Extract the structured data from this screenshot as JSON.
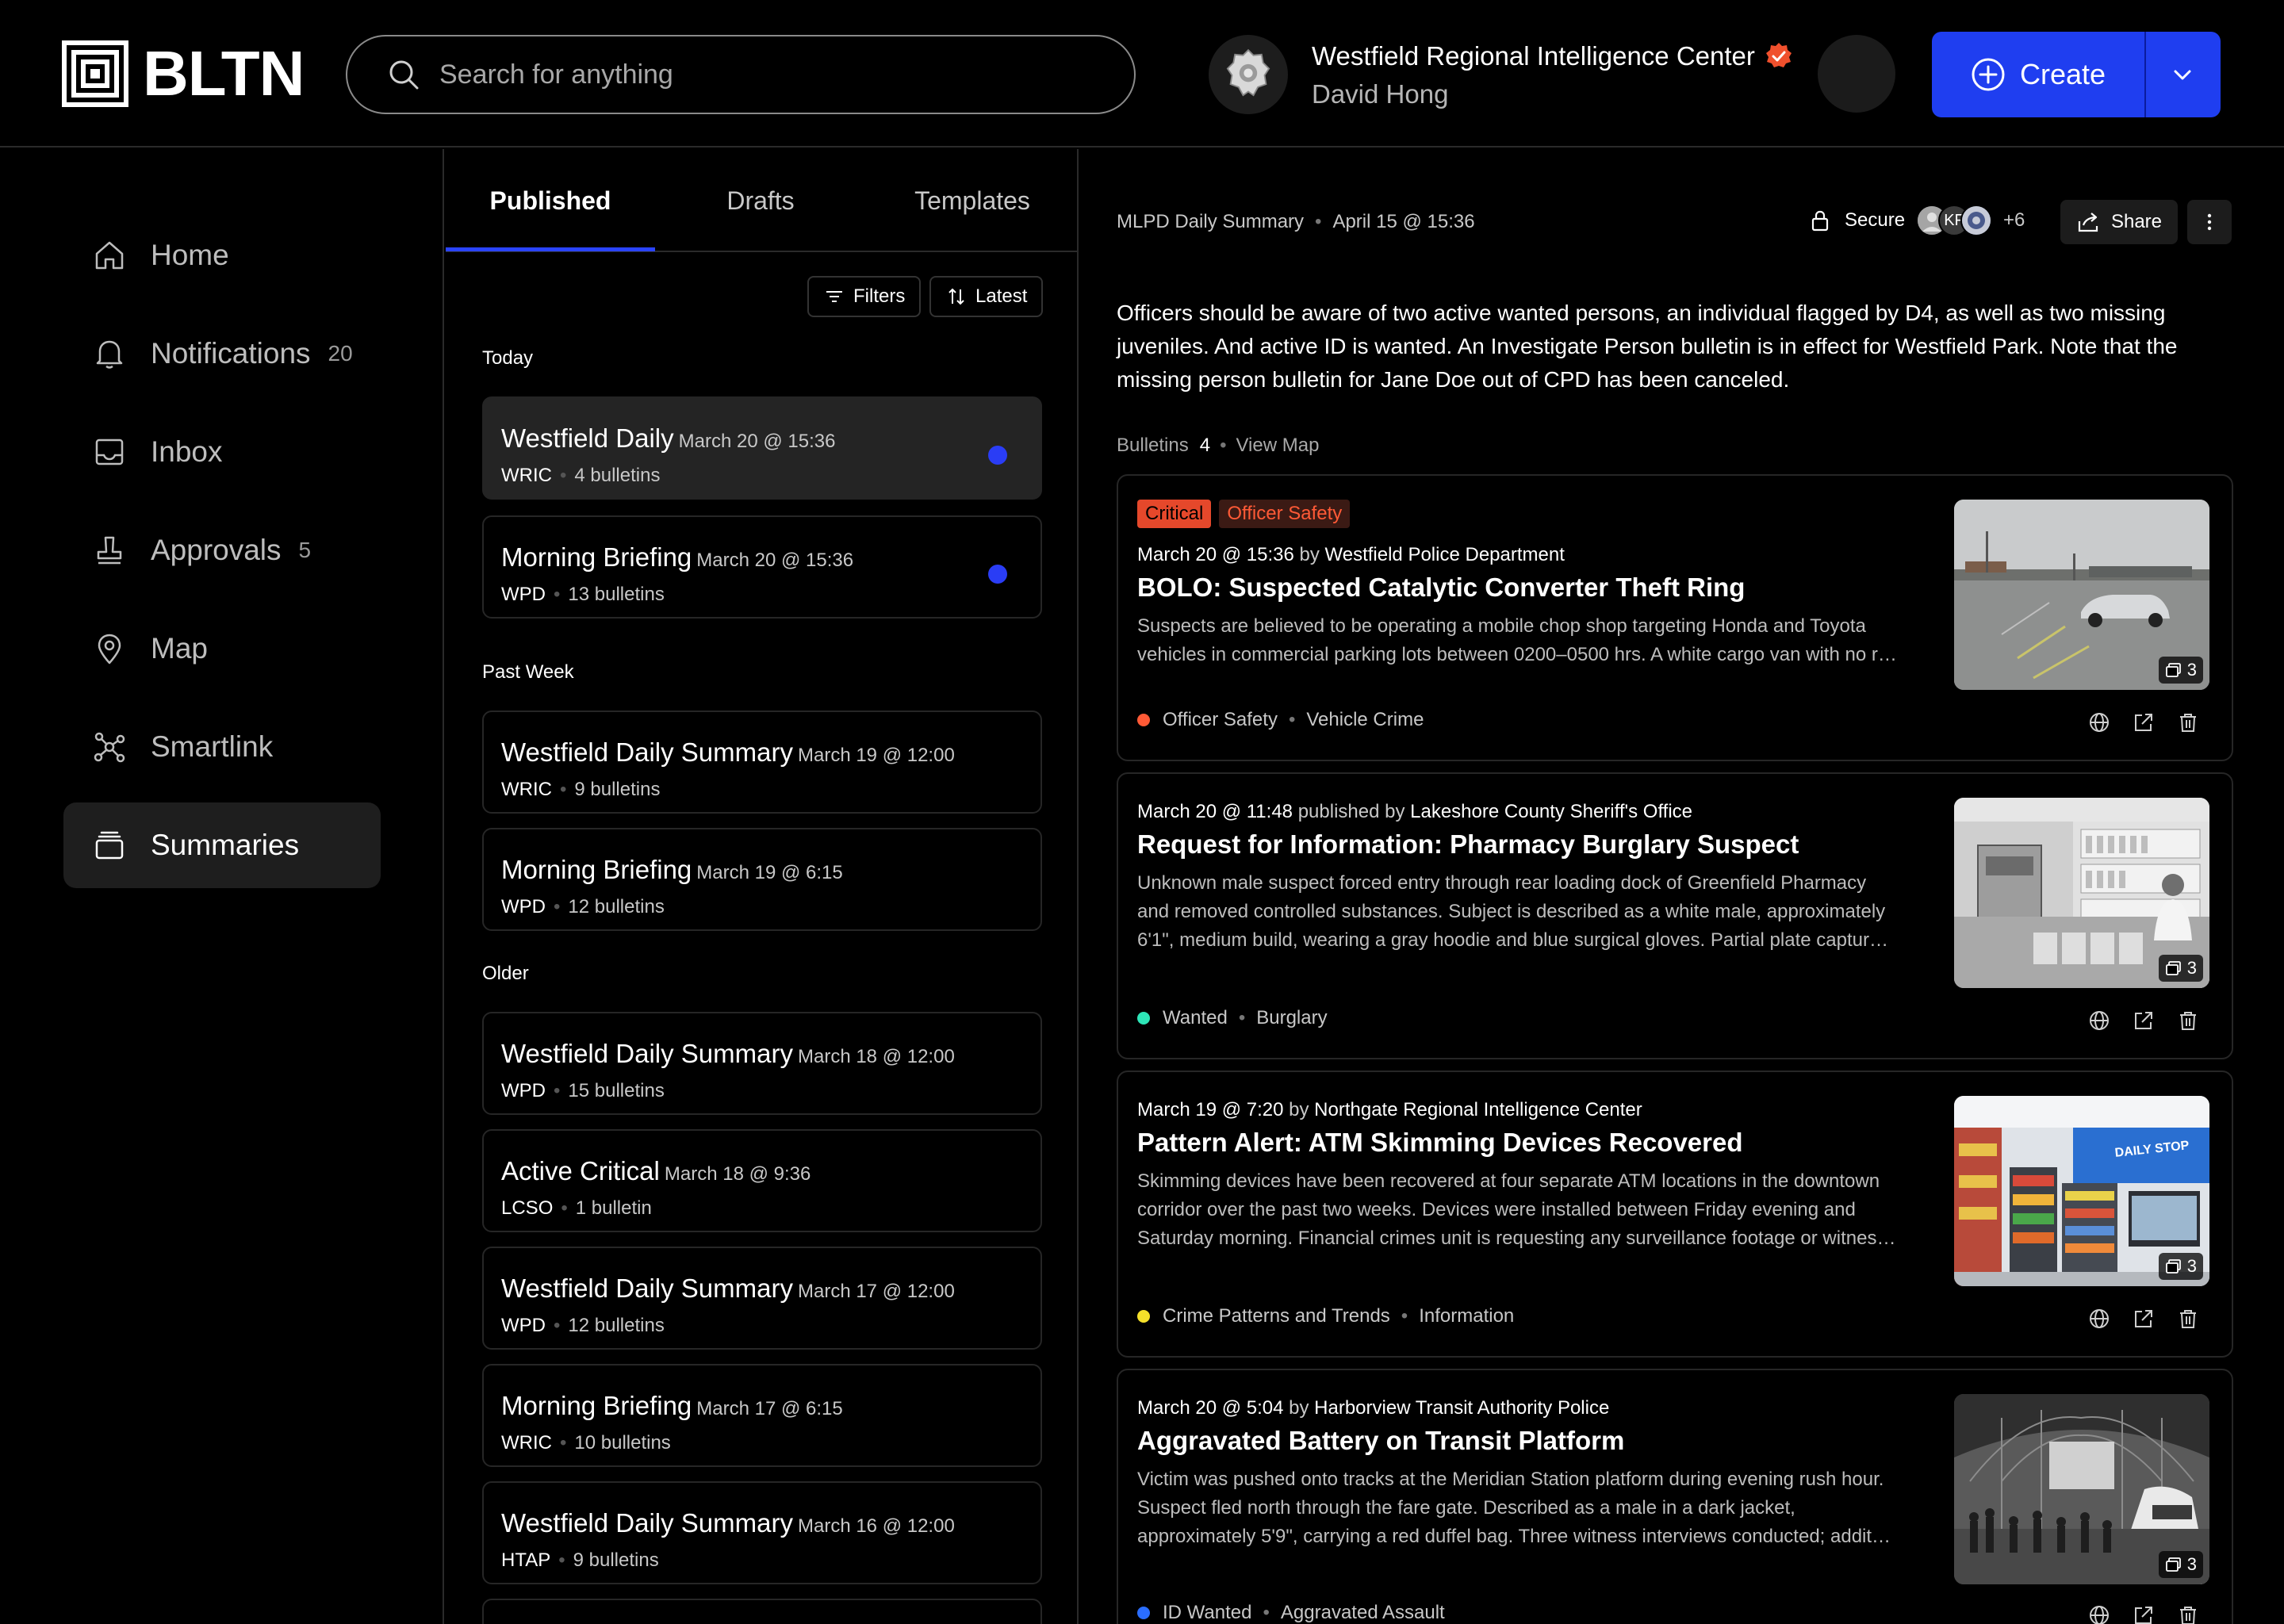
{
  "header": {
    "logo_text": "BLTN",
    "search_placeholder": "Search for anything",
    "org_name": "Westfield Regional Intelligence Center",
    "user_name": "David Hong",
    "create_label": "Create",
    "brand_color": "#1f3ef0"
  },
  "sidebar": {
    "items": [
      {
        "label": "Home",
        "icon": "home-icon"
      },
      {
        "label": "Notifications",
        "count": "20",
        "icon": "bell-icon"
      },
      {
        "label": "Inbox",
        "icon": "inbox-icon"
      },
      {
        "label": "Approvals",
        "count": "5",
        "icon": "stamp-icon"
      },
      {
        "label": "Map",
        "icon": "map-pin-icon"
      },
      {
        "label": "Smartlink",
        "icon": "network-icon"
      },
      {
        "label": "Summaries",
        "icon": "stack-icon",
        "active": true
      }
    ]
  },
  "list": {
    "tabs": [
      "Published",
      "Drafts",
      "Templates"
    ],
    "active_tab": "Published",
    "filters_label": "Filters",
    "sort_label": "Latest",
    "groups": [
      {
        "label": "Today",
        "items": [
          {
            "title": "Westfield Daily",
            "date": "March 20 @ 15:36",
            "agency": "WRIC",
            "count": "4 bulletins",
            "unread": true,
            "selected": true
          },
          {
            "title": "Morning Briefing",
            "date": "March 20 @ 15:36",
            "agency": "WPD",
            "count": "13 bulletins",
            "unread": true
          }
        ]
      },
      {
        "label": "Past Week",
        "items": [
          {
            "title": "Westfield Daily Summary",
            "date": "March 19 @ 12:00",
            "agency": "WRIC",
            "count": "9 bulletins"
          },
          {
            "title": "Morning Briefing",
            "date": "March 19 @ 6:15",
            "agency": "WPD",
            "count": "12 bulletins"
          }
        ]
      },
      {
        "label": "Older",
        "items": [
          {
            "title": "Westfield Daily Summary",
            "date": "March 18 @ 12:00",
            "agency": "WPD",
            "count": "15 bulletins"
          },
          {
            "title": "Active Critical",
            "date": "March 18 @ 9:36",
            "agency": "LCSO",
            "count": "1 bulletin"
          },
          {
            "title": "Westfield Daily Summary",
            "date": "March 17 @ 12:00",
            "agency": "WPD",
            "count": "12 bulletins"
          },
          {
            "title": "Morning Briefing",
            "date": "March 17 @ 6:15",
            "agency": "WRIC",
            "count": "10 bulletins"
          },
          {
            "title": "Westfield Daily Summary",
            "date": "March 16 @ 12:00",
            "agency": "HTAP",
            "count": "9 bulletins"
          }
        ]
      }
    ]
  },
  "detail": {
    "summary_name": "MLPD Daily Summary",
    "summary_date": "April 15 @ 15:36",
    "secure_label": "Secure",
    "avatar_initials": "KF",
    "extra_members": "+6",
    "share_label": "Share",
    "summary_text": "Officers should be aware of two active wanted persons, an individual flagged by D4, as well as two missing juveniles. And active ID is wanted. An Investigate Person bulletin is in effect for Westfield Park. Note that the missing person bulletin for Jane Doe out of CPD has been canceled.",
    "bulletins_label": "Bulletins",
    "bulletins_count": "4",
    "view_map_label": "View Map",
    "bulletins": [
      {
        "tags": [
          "Critical",
          "Officer Safety"
        ],
        "date": "March 20 @ 15:36",
        "by_label": "by",
        "agency": "Westfield Police Department",
        "title": "BOLO: Suspected Catalytic Converter Theft Ring",
        "desc": [
          "Suspects are believed to be operating a mobile chop shop targeting Honda and Toyota",
          "vehicles in commercial parking lots between 0200–0500 hrs. A white cargo van with no r…"
        ],
        "categories": [
          "Officer Safety",
          "Vehicle Crime"
        ],
        "cat_color": "#ff5a36",
        "image_count": "3",
        "image": "parking-lot"
      },
      {
        "tags": [],
        "date": "March 20 @ 11:48",
        "by_label": "published by",
        "agency": "Lakeshore County Sheriff's Office",
        "title": "Request for Information: Pharmacy Burglary Suspect",
        "desc": [
          "Unknown male suspect forced entry through rear loading dock of Greenfield Pharmacy",
          "and removed controlled substances. Subject is described as a white male, approximately",
          "6'1\", medium build, wearing a gray hoodie and blue surgical gloves. Partial plate captur…"
        ],
        "categories": [
          "Wanted",
          "Burglary"
        ],
        "cat_color": "#2ee6b8",
        "image_count": "3",
        "image": "pharmacy"
      },
      {
        "tags": [],
        "date": "March 19 @ 7:20",
        "by_label": "by",
        "agency": "Northgate Regional Intelligence Center",
        "title": "Pattern Alert: ATM Skimming Devices Recovered",
        "desc": [
          "Skimming devices have been recovered at four separate ATM locations in the downtown",
          "corridor over the past two weeks. Devices were installed between Friday evening and",
          "Saturday morning. Financial crimes unit is requesting any surveillance footage or witnes…"
        ],
        "categories": [
          "Crime Patterns and Trends",
          "Information"
        ],
        "cat_color": "#f5e02a",
        "image_count": "3",
        "image": "store",
        "store_sign": "DAILY STOP"
      },
      {
        "tags": [],
        "date": "March 20 @ 5:04",
        "by_label": "by",
        "agency": "Harborview Transit Authority Police",
        "title": "Aggravated Battery on Transit Platform",
        "desc": [
          "Victim was pushed onto tracks at the Meridian Station platform during evening rush hour.",
          "Suspect fled north through the fare gate. Described as a male in a dark jacket,",
          "approximately 5'9\", carrying a red duffel bag. Three witness interviews conducted; addit…"
        ],
        "categories": [
          "ID Wanted",
          "Aggravated Assault"
        ],
        "cat_color": "#2a6dff",
        "image_count": "3",
        "image": "station"
      }
    ]
  }
}
